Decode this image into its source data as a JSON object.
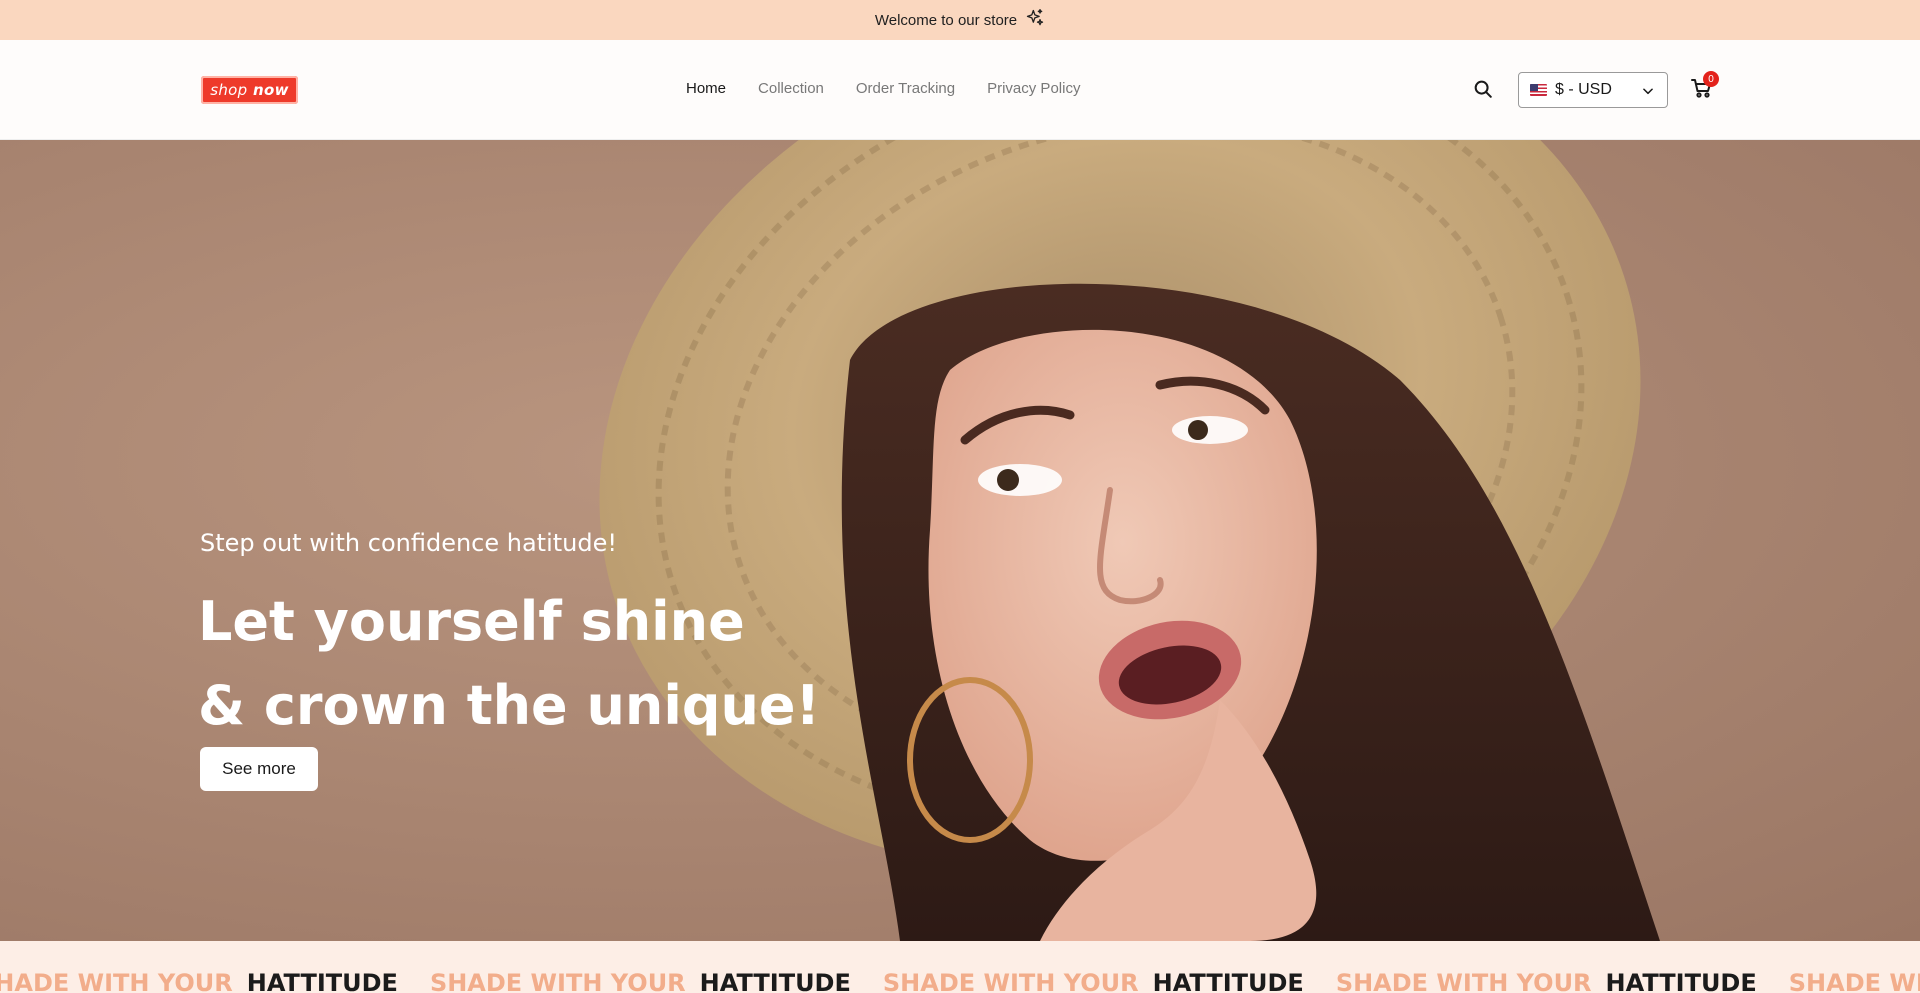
{
  "announcement": {
    "text": "Welcome to our store",
    "icon": "sparkle-icon"
  },
  "header": {
    "logo": {
      "part1": "shop",
      "part2": "now"
    },
    "nav": [
      {
        "label": "Home",
        "active": true
      },
      {
        "label": "Collection",
        "active": false
      },
      {
        "label": "Order Tracking",
        "active": false
      },
      {
        "label": "Privacy Policy",
        "active": false
      }
    ],
    "currency": {
      "value": "$ - USD",
      "flag": "us-flag-icon"
    },
    "cart_count": "0"
  },
  "hero": {
    "subtitle": "Step out with confidence hatitude!",
    "title_line1": "Let yourself shine",
    "title_line2": "& crown the unique!",
    "button": "See more"
  },
  "marquee": {
    "part1": "SHADE WITH YOUR",
    "part2": "HATTITUDE"
  },
  "colors": {
    "announcement_bg": "#fad7bf",
    "brand_red": "#ee3a2a",
    "marquee_accent": "#f2ad8b",
    "badge": "#e3221b"
  }
}
